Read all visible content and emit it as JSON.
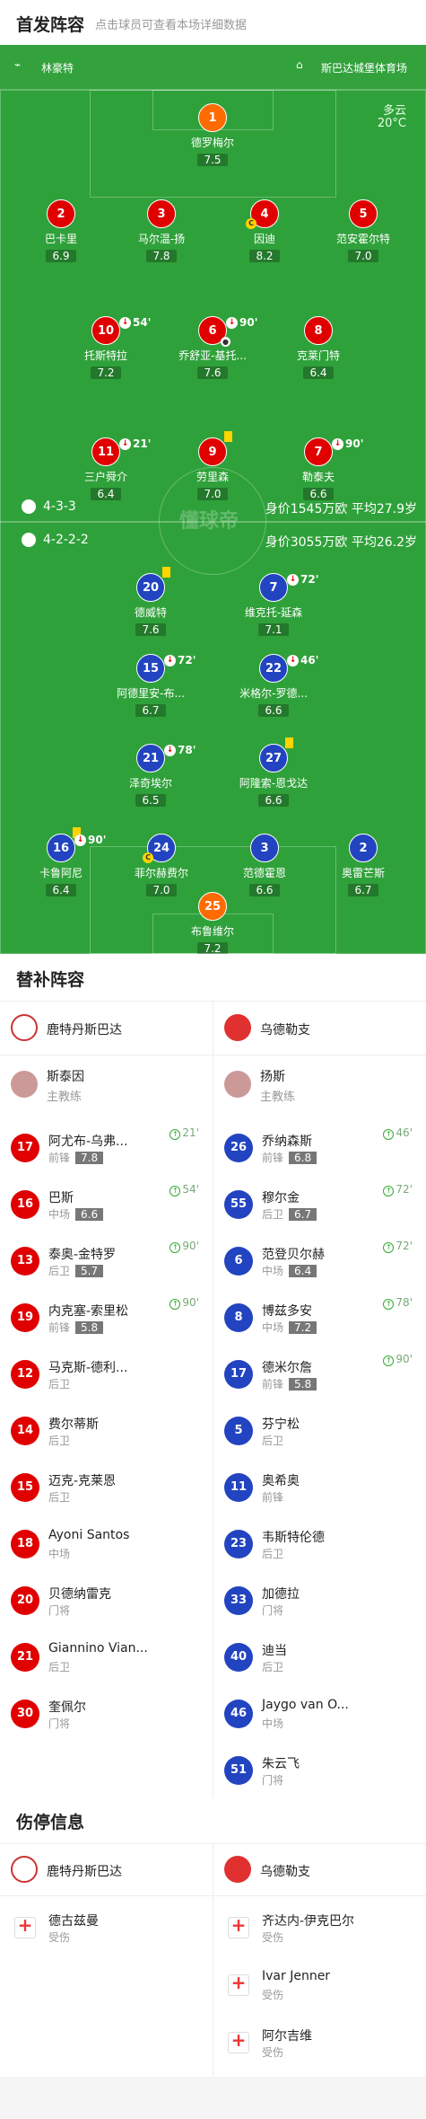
{
  "header": {
    "title": "首发阵容",
    "hint": "点击球员可查看本场详细数据"
  },
  "info": {
    "referee": "林豪特",
    "stadium": "斯巴达城堡体育场",
    "weather": "多云",
    "temp": "20°C"
  },
  "home": {
    "formation": "4-3-3",
    "value": "身价1545万欧 平均27.9岁"
  },
  "away": {
    "formation": "4-2-2-2",
    "value": "身价3055万欧 平均26.2岁"
  },
  "watermark": "懂球帝",
  "home_players": [
    {
      "num": "1",
      "name": "德罗梅尔",
      "rating": "7.5",
      "c": "o"
    },
    {
      "num": "2",
      "name": "巴卡里",
      "rating": "6.9",
      "c": "r"
    },
    {
      "num": "3",
      "name": "马尔温-扬",
      "rating": "7.8",
      "c": "r"
    },
    {
      "num": "4",
      "name": "因迪",
      "rating": "8.2",
      "c": "r"
    },
    {
      "num": "5",
      "name": "范安霍尔特",
      "rating": "7.0",
      "c": "r"
    },
    {
      "num": "10",
      "name": "托斯特拉",
      "rating": "7.2",
      "c": "r",
      "sub": "54'"
    },
    {
      "num": "6",
      "name": "乔舒亚-基托...",
      "rating": "7.6",
      "c": "r",
      "sub": "90'"
    },
    {
      "num": "8",
      "name": "克莱门特",
      "rating": "6.4",
      "c": "r"
    },
    {
      "num": "11",
      "name": "三户舜介",
      "rating": "6.4",
      "c": "r",
      "sub": "21'"
    },
    {
      "num": "9",
      "name": "劳里森",
      "rating": "7.0",
      "c": "r"
    },
    {
      "num": "7",
      "name": "勒泰夫",
      "rating": "6.6",
      "c": "r",
      "sub": "90'"
    }
  ],
  "away_players": [
    {
      "num": "20",
      "name": "德威特",
      "rating": "7.6",
      "c": "b"
    },
    {
      "num": "7",
      "name": "维克托-延森",
      "rating": "7.1",
      "c": "b",
      "sub": "72'"
    },
    {
      "num": "15",
      "name": "阿德里安-布...",
      "rating": "6.7",
      "c": "b",
      "sub": "72'"
    },
    {
      "num": "22",
      "name": "米格尔-罗德...",
      "rating": "6.6",
      "c": "b",
      "sub": "46'"
    },
    {
      "num": "21",
      "name": "泽奇埃尔",
      "rating": "6.5",
      "c": "b",
      "sub": "78'"
    },
    {
      "num": "27",
      "name": "阿隆索-恩戈达",
      "rating": "6.6",
      "c": "b"
    },
    {
      "num": "16",
      "name": "卡鲁阿尼",
      "rating": "6.4",
      "c": "b",
      "sub": "90'"
    },
    {
      "num": "24",
      "name": "菲尔赫费尔",
      "rating": "7.0",
      "c": "b"
    },
    {
      "num": "3",
      "name": "范德霍恩",
      "rating": "6.6",
      "c": "b"
    },
    {
      "num": "2",
      "name": "奥雷芒斯",
      "rating": "6.7",
      "c": "b"
    },
    {
      "num": "25",
      "name": "布鲁维尔",
      "rating": "7.2",
      "c": "o"
    }
  ],
  "subs": {
    "title": "替补阵容",
    "home_team": "鹿特丹斯巴达",
    "away_team": "乌德勒支",
    "home_coach": {
      "name": "斯泰因",
      "role": "主教练"
    },
    "away_coach": {
      "name": "扬斯",
      "role": "主教练"
    },
    "home": [
      {
        "num": "17",
        "name": "阿尤布-乌弗...",
        "pos": "前锋",
        "rating": "7.8",
        "time": "21'"
      },
      {
        "num": "16",
        "name": "巴斯",
        "pos": "中场",
        "rating": "6.6",
        "time": "54'"
      },
      {
        "num": "13",
        "name": "泰奥-金特罗",
        "pos": "后卫",
        "rating": "5.7",
        "time": "90'"
      },
      {
        "num": "19",
        "name": "内克塞-索里松",
        "pos": "前锋",
        "rating": "5.8",
        "time": "90'"
      },
      {
        "num": "12",
        "name": "马克斯-德利...",
        "pos": "后卫"
      },
      {
        "num": "14",
        "name": "费尔蒂斯",
        "pos": "后卫"
      },
      {
        "num": "15",
        "name": "迈克-克莱恩",
        "pos": "后卫"
      },
      {
        "num": "18",
        "name": "Ayoni Santos",
        "pos": "中场"
      },
      {
        "num": "20",
        "name": "贝德纳雷克",
        "pos": "门将"
      },
      {
        "num": "21",
        "name": "Giannino Vian...",
        "pos": "后卫"
      },
      {
        "num": "30",
        "name": "奎佩尔",
        "pos": "门将"
      }
    ],
    "away": [
      {
        "num": "26",
        "name": "乔纳森斯",
        "pos": "前锋",
        "rating": "6.8",
        "time": "46'"
      },
      {
        "num": "55",
        "name": "穆尔金",
        "pos": "后卫",
        "rating": "6.7",
        "time": "72'"
      },
      {
        "num": "6",
        "name": "范登贝尔赫",
        "pos": "中场",
        "rating": "6.4",
        "time": "72'"
      },
      {
        "num": "8",
        "name": "博兹多安",
        "pos": "中场",
        "rating": "7.2",
        "time": "78'"
      },
      {
        "num": "17",
        "name": "德米尔詹",
        "pos": "前锋",
        "rating": "5.8",
        "time": "90'"
      },
      {
        "num": "5",
        "name": "芬宁松",
        "pos": "后卫"
      },
      {
        "num": "11",
        "name": "奥希奥",
        "pos": "前锋"
      },
      {
        "num": "23",
        "name": "韦斯特伦德",
        "pos": "后卫"
      },
      {
        "num": "33",
        "name": "加德拉",
        "pos": "门将"
      },
      {
        "num": "40",
        "name": "迪当",
        "pos": "后卫"
      },
      {
        "num": "46",
        "name": "Jaygo van O...",
        "pos": "中场"
      },
      {
        "num": "51",
        "name": "朱云飞",
        "pos": "门将"
      }
    ]
  },
  "injuries": {
    "title": "伤停信息",
    "home_team": "鹿特丹斯巴达",
    "away_team": "乌德勒支",
    "home": [
      {
        "name": "德古兹曼",
        "status": "受伤"
      }
    ],
    "away": [
      {
        "name": "齐达内-伊克巴尔",
        "status": "受伤"
      },
      {
        "name": "Ivar Jenner",
        "status": "受伤"
      },
      {
        "name": "阿尔吉维",
        "status": "受伤"
      }
    ]
  }
}
